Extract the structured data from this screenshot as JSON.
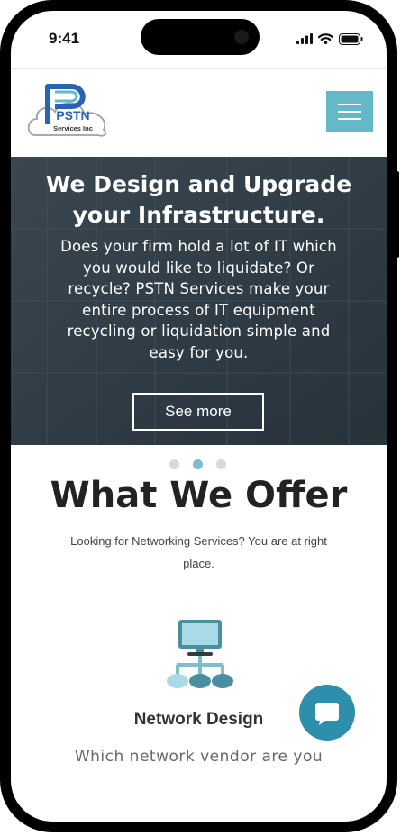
{
  "status_bar": {
    "time": "9:41",
    "icons": [
      "signal-icon",
      "wifi-icon",
      "battery-icon"
    ]
  },
  "header": {
    "logo": {
      "text": "PSTN",
      "subtext": "Services Inc"
    },
    "menu_icon": "hamburger-menu-icon"
  },
  "hero": {
    "title_line1": "We Design and Upgrade",
    "title_line2": "your Infrastructure.",
    "text_lines": [
      "Does your firm hold a lot of IT which",
      "you would like to liquidate? Or",
      "recycle? PSTN Services make your",
      "entire process of IT equipment",
      "recycling or liquidation simple and",
      "easy for you."
    ],
    "button_label": "See more"
  },
  "slider": {
    "count": 3,
    "active_index": 1
  },
  "offer": {
    "title": "What We Offer",
    "subtitle_line1": "Looking for Networking Services? You are at right",
    "subtitle_line2": "place."
  },
  "service": {
    "icon": "network-design-icon",
    "title": "Network Design",
    "text": "Which network vendor are you"
  },
  "chat": {
    "icon": "chat-bubble-icon"
  },
  "colors": {
    "accent": "#64b9c8",
    "hero_bg": "#2d3944",
    "chat": "#2e8fad",
    "logo_blue": "#2a63b3"
  }
}
